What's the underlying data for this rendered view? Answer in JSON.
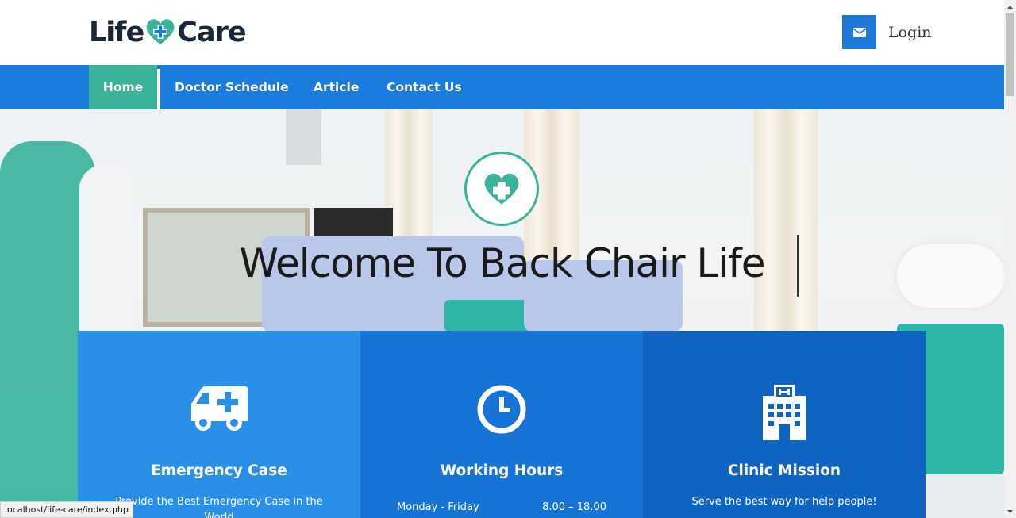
{
  "header": {
    "logo_left": "Life",
    "logo_right": "Care",
    "login_label": "Login"
  },
  "nav": {
    "items": [
      {
        "label": "Home",
        "active": true
      },
      {
        "label": "Doctor Schedule"
      },
      {
        "label": "Article"
      },
      {
        "label": "Contact Us"
      }
    ]
  },
  "hero": {
    "title": "Welcome To Back Chair Life"
  },
  "cards": [
    {
      "title": "Emergency Case",
      "text": "Provide the Best Emergency Case in the World",
      "icon": "ambulance-icon"
    },
    {
      "title": "Working Hours",
      "hours_day": "Monday - Friday",
      "hours_time": "8.00 – 18.00",
      "icon": "clock-icon"
    },
    {
      "title": "Clinic Mission",
      "text": "Serve the best way for help people!",
      "icon": "hospital-icon"
    }
  ],
  "status_url": "localhost/life-care/index.php",
  "colors": {
    "nav": "#1a7ddd",
    "accent": "#3bb39a",
    "card1": "#2a8fe6",
    "card2": "#1674d6",
    "card3": "#0f64c1"
  }
}
